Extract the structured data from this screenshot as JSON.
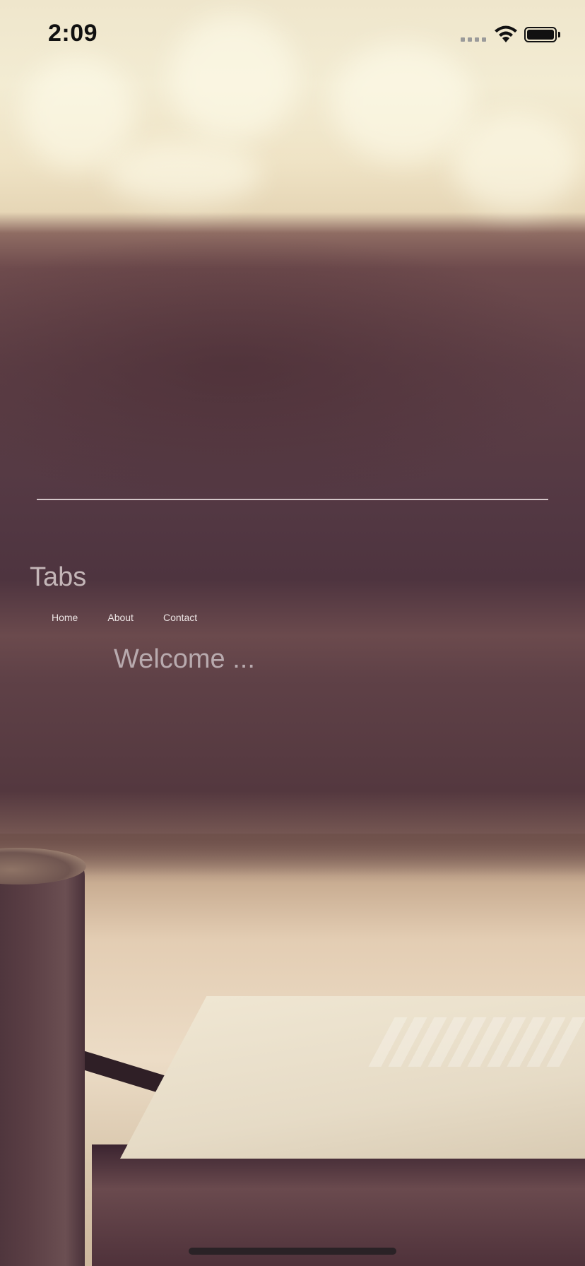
{
  "status_bar": {
    "time": "2:09",
    "icons": [
      "cellular-signal-icon",
      "wifi-icon",
      "battery-icon"
    ]
  },
  "app": {
    "title": "Tabs",
    "tabs": [
      {
        "label": "Home"
      },
      {
        "label": "About"
      },
      {
        "label": "Contact"
      }
    ],
    "welcome_text": "Welcome ..."
  },
  "colors": {
    "title_text": "#c4b6b8",
    "tab_text": "#ece4e4",
    "welcome_text": "#b8aaae",
    "divider": "#ebe1e1"
  }
}
